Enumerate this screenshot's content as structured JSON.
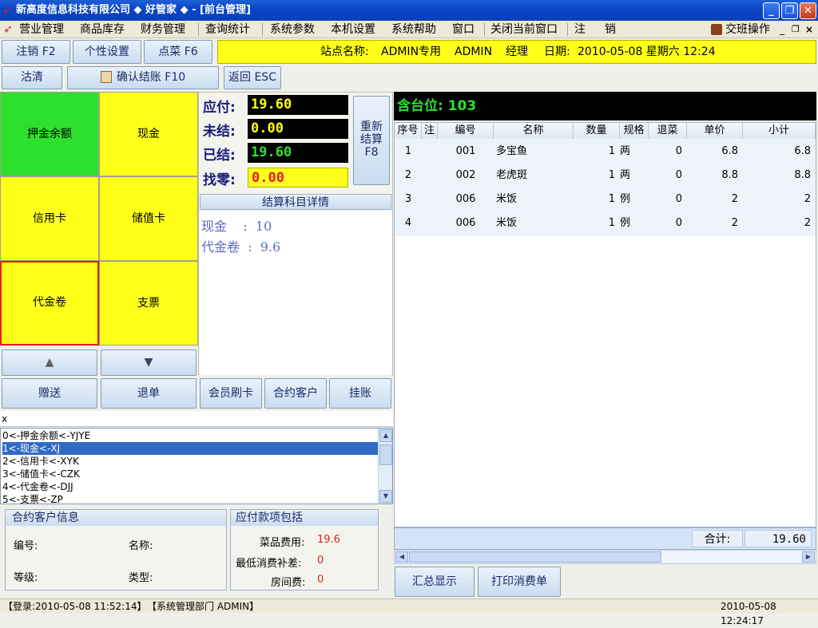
{
  "window": {
    "title": "新高度信息科技有限公司 ◆ 好管家 ◆ - [前台管理]"
  },
  "menu": {
    "items": [
      "营业管理",
      "商品库存",
      "财务管理",
      "查询统计",
      "系统参数",
      "本机设置",
      "系统帮助",
      "窗口",
      "关闭当前窗口",
      "注",
      "销"
    ],
    "right": "交班操作"
  },
  "toolbar": {
    "logout": "注销 F2",
    "personal": "个性设置",
    "order": "点菜 F6",
    "clear": "沽清",
    "confirm": "确认结账 F10",
    "back": "返回 ESC"
  },
  "station": {
    "label": "站点名称:",
    "name": "ADMIN专用",
    "user": "ADMIN",
    "role": "经理",
    "date_label": "日期:",
    "date": "2010-05-08 星期六 12:24"
  },
  "pay_methods": [
    {
      "label": "押金余额",
      "color": "#2ee02e"
    },
    {
      "label": "现金",
      "color": "#ffff1a"
    },
    {
      "label": "信用卡",
      "color": "#ffff1a"
    },
    {
      "label": "储值卡",
      "color": "#ffff1a"
    },
    {
      "label": "代金卷",
      "color": "#ffff1a"
    },
    {
      "label": "支票",
      "color": "#ffff1a"
    }
  ],
  "amounts": {
    "due_label": "应付:",
    "due": "19.60",
    "unsettled_label": "未结:",
    "unsettled": "0.00",
    "settled_label": "已结:",
    "settled": "19.60",
    "change_label": "找零:",
    "change": "0.00"
  },
  "recalc": {
    "l1": "重新",
    "l2": "结算",
    "l3": "F8"
  },
  "detail": {
    "title": "结算科目详情",
    "lines": [
      "现金    :  10",
      "代金卷  :  9.6"
    ]
  },
  "actions": {
    "gift": "赠送",
    "cancel": "退单",
    "member": "会员刷卡",
    "contract": "合约客户",
    "credit": "挂账"
  },
  "search": {
    "value": "x"
  },
  "codes": [
    "0<-押金余额<-YJYE",
    "1<-现金<-XJ",
    "2<-信用卡<-XYK",
    "3<-储值卡<-CZK",
    "4<-代金卷<-DJJ",
    "5<-支票<-ZP"
  ],
  "contract_info": {
    "title": "合约客户信息",
    "code": "编号:",
    "name": "名称:",
    "level": "等级:",
    "type": "类型:"
  },
  "payables": {
    "title": "应付款项包括",
    "dish_label": "菜品费用:",
    "dish": "19.6",
    "min_label": "最低消费补差:",
    "min": "0",
    "room_label": "房间费:",
    "room": "0"
  },
  "table": {
    "header": "含台位: 103",
    "columns": [
      "序号",
      "注",
      "编号",
      "名称",
      "数量",
      "规格",
      "退菜",
      "单价",
      "小计"
    ],
    "rows": [
      [
        "1",
        "",
        "001",
        "多宝鱼",
        "1",
        "两",
        "0",
        "6.8",
        "6.8"
      ],
      [
        "2",
        "",
        "002",
        "老虎斑",
        "1",
        "两",
        "0",
        "8.8",
        "8.8"
      ],
      [
        "3",
        "",
        "006",
        "米饭",
        "1",
        "例",
        "0",
        "2",
        "2"
      ],
      [
        "4",
        "",
        "006",
        "米饭",
        "1",
        "例",
        "0",
        "2",
        "2"
      ]
    ],
    "total_label": "合计:",
    "total": "19.60"
  },
  "bottom": {
    "summary": "汇总显示",
    "print": "打印消费单"
  },
  "status": {
    "login": "【登录:2010-05-08 11:52:14】",
    "dept": "【系统管理部门  ADMIN】",
    "time": "2010-05-08 12:24:17"
  }
}
